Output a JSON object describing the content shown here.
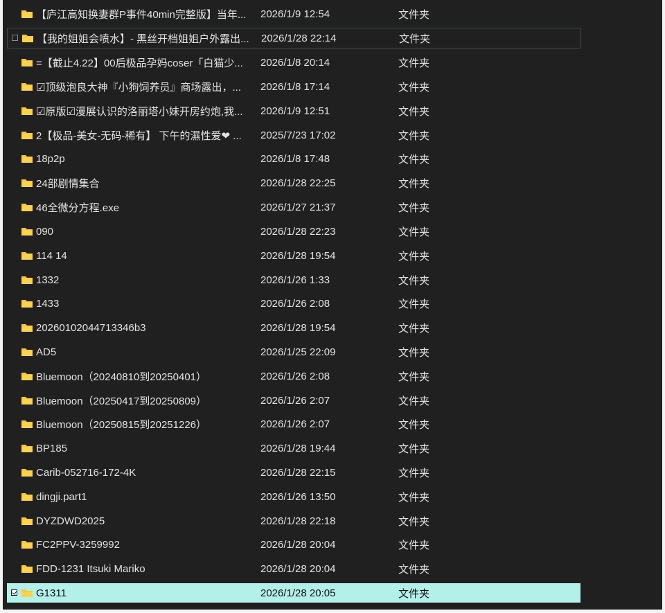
{
  "colors": {
    "background": "#202020",
    "text": "#e3e3e3",
    "folder": "#f8c43a",
    "selected_row": "#b3f0ea"
  },
  "file_list": {
    "rows": [
      {
        "name": "【庐江高知换妻群P事件40min完整版】当年...",
        "date": "2026/1/9 12:54",
        "type": "文件夹",
        "icon": "folder-icon"
      },
      {
        "name": "【我的姐姐会喷水】- 黑丝开档姐姐户外露出...",
        "date": "2026/1/28 22:14",
        "type": "文件夹",
        "icon": "folder-icon"
      },
      {
        "name": "=【截止4.22】00后极品孕妈coser「白猫少...",
        "date": "2026/1/8 20:14",
        "type": "文件夹",
        "icon": "folder-icon"
      },
      {
        "name": "☑顶级泡良大神『小狗饲养员』商场露出，...",
        "date": "2026/1/8 17:14",
        "type": "文件夹",
        "icon": "folder-icon"
      },
      {
        "name": "☑原版☑漫展认识的洛丽塔小妹开房约炮,我...",
        "date": "2026/1/9 12:51",
        "type": "文件夹",
        "icon": "folder-icon"
      },
      {
        "name": "2【极品-美女-无码-稀有】 下午的濕性爱❤ ...",
        "date": "2025/7/23 17:02",
        "type": "文件夹",
        "icon": "folder-icon"
      },
      {
        "name": "18p2p",
        "date": "2026/1/8 17:48",
        "type": "文件夹",
        "icon": "folder-icon"
      },
      {
        "name": "24部剧情集合",
        "date": "2026/1/28 22:25",
        "type": "文件夹",
        "icon": "folder-icon"
      },
      {
        "name": "46全微分方程.exe",
        "date": "2026/1/27 21:37",
        "type": "文件夹",
        "icon": "folder-icon"
      },
      {
        "name": "090",
        "date": "2026/1/28 22:23",
        "type": "文件夹",
        "icon": "folder-icon"
      },
      {
        "name": "114 14",
        "date": "2026/1/28 19:54",
        "type": "文件夹",
        "icon": "folder-icon"
      },
      {
        "name": "1332",
        "date": "2026/1/26 1:33",
        "type": "文件夹",
        "icon": "folder-icon"
      },
      {
        "name": "1433",
        "date": "2026/1/26 2:08",
        "type": "文件夹",
        "icon": "folder-icon"
      },
      {
        "name": "20260102044713346b3",
        "date": "2026/1/28 19:54",
        "type": "文件夹",
        "icon": "folder-icon"
      },
      {
        "name": "AD5",
        "date": "2026/1/25 22:09",
        "type": "文件夹",
        "icon": "folder-icon"
      },
      {
        "name": "Bluemoon（20240810到20250401）",
        "date": "2026/1/26 2:08",
        "type": "文件夹",
        "icon": "folder-icon"
      },
      {
        "name": "Bluemoon（20250417到20250809）",
        "date": "2026/1/26 2:07",
        "type": "文件夹",
        "icon": "folder-icon"
      },
      {
        "name": "Bluemoon（20250815到20251226）",
        "date": "2026/1/26 2:07",
        "type": "文件夹",
        "icon": "folder-icon"
      },
      {
        "name": "BP185",
        "date": "2026/1/28 19:44",
        "type": "文件夹",
        "icon": "folder-icon"
      },
      {
        "name": "Carib-052716-172-4K",
        "date": "2026/1/28 22:15",
        "type": "文件夹",
        "icon": "folder-icon"
      },
      {
        "name": "dingji.part1",
        "date": "2026/1/26 13:50",
        "type": "文件夹",
        "icon": "folder-icon"
      },
      {
        "name": "DYZDWD2025",
        "date": "2026/1/28 22:18",
        "type": "文件夹",
        "icon": "folder-icon"
      },
      {
        "name": "FC2PPV-3259992",
        "date": "2026/1/28 20:04",
        "type": "文件夹",
        "icon": "folder-icon"
      },
      {
        "name": "FDD-1231 Itsuki Mariko",
        "date": "2026/1/28 20:04",
        "type": "文件夹",
        "icon": "folder-icon"
      },
      {
        "name": "G1311",
        "date": "2026/1/28 20:05",
        "type": "文件夹",
        "icon": "folder-icon",
        "selected": true,
        "checked": true
      }
    ]
  }
}
